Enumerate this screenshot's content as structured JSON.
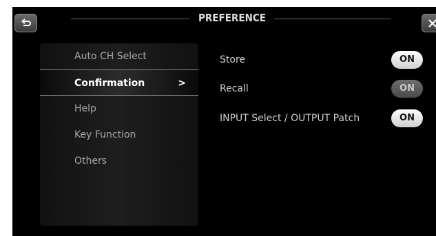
{
  "header": {
    "title": "PREFERENCE",
    "back_icon": "return-arrow-icon",
    "close_icon": "close-icon"
  },
  "sidebar": {
    "items": [
      {
        "label": "Auto CH Select"
      },
      {
        "label": "Confirmation",
        "selected": true,
        "arrow": ">"
      },
      {
        "label": "Help"
      },
      {
        "label": "Key Function"
      },
      {
        "label": "Others"
      }
    ]
  },
  "settings": [
    {
      "label": "Store",
      "toggle": "ON",
      "state": "on"
    },
    {
      "label": "Recall",
      "toggle": "ON",
      "state": "dimmed"
    },
    {
      "label": "INPUT Select / OUTPUT Patch",
      "toggle": "ON",
      "state": "on"
    }
  ],
  "colors": {
    "background": "#000000",
    "toggle_on": "#f0f0f0",
    "toggle_dim": "#5a5a5a",
    "selected_text": "#ffffff",
    "menu_text": "#a8a8a8"
  }
}
